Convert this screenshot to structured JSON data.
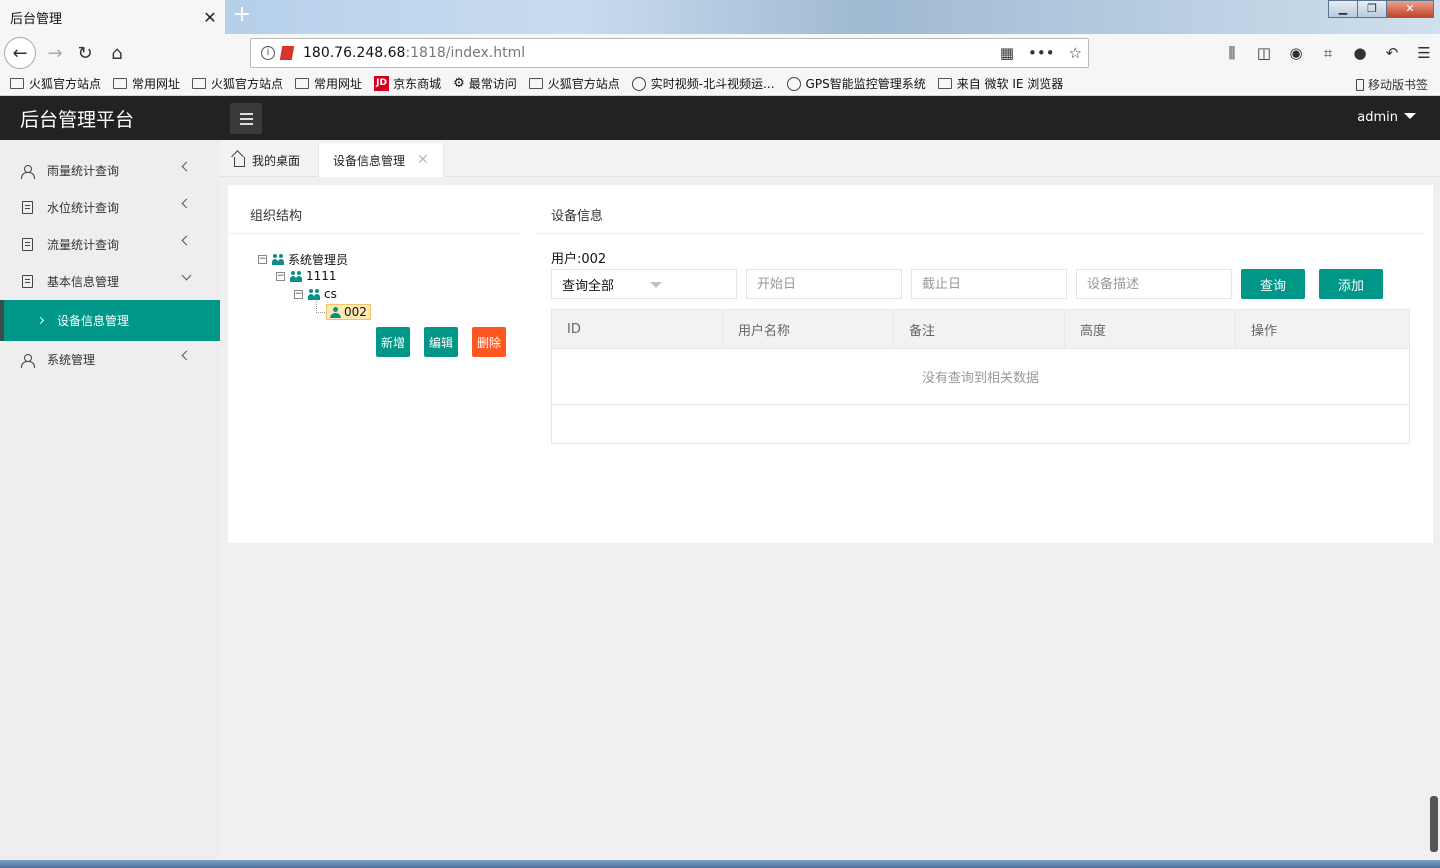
{
  "browser": {
    "tab_title": "后台管理",
    "tab_close": "✕",
    "new_tab": "+",
    "url_host": "180.76.248.68",
    "url_rest": ":1818/index.html",
    "window_buttons": [
      "▁",
      "❐",
      "✕"
    ]
  },
  "bookmarks": [
    {
      "label": "火狐官方站点",
      "icon": "folder-icon"
    },
    {
      "label": "常用网址",
      "icon": "folder-icon"
    },
    {
      "label": "火狐官方站点",
      "icon": "folder-icon"
    },
    {
      "label": "常用网址",
      "icon": "folder-icon"
    },
    {
      "label": "京东商城",
      "icon": "jd-icon",
      "badge": "JD"
    },
    {
      "label": "最常访问",
      "icon": "gear-icon"
    },
    {
      "label": "火狐官方站点",
      "icon": "folder-icon"
    },
    {
      "label": "实时视频-北斗视频运...",
      "icon": "globe-icon"
    },
    {
      "label": "GPS智能监控管理系统",
      "icon": "globe-icon"
    },
    {
      "label": "来自 微软 IE 浏览器",
      "icon": "folder-icon"
    }
  ],
  "mobile_bookmarks": "移动版书签",
  "header": {
    "brand": "后台管理平台",
    "user": "admin"
  },
  "sidebar": {
    "items": [
      {
        "label": "雨量统计查询",
        "icon": "user-icon"
      },
      {
        "label": "水位统计查询",
        "icon": "document-icon"
      },
      {
        "label": "流量统计查询",
        "icon": "document-icon"
      },
      {
        "label": "基本信息管理",
        "icon": "document-icon",
        "expanded": true
      },
      {
        "label": "系统管理",
        "icon": "user-icon"
      }
    ],
    "active_sub": "设备信息管理"
  },
  "page_tabs": {
    "home": "我的桌面",
    "active": "设备信息管理",
    "close": "✕"
  },
  "org_panel": {
    "title": "组织结构",
    "tree": {
      "root": "系统管理员",
      "child": "1111",
      "grandchild": "cs",
      "leaf": "002"
    },
    "buttons": {
      "add": "新增",
      "edit": "编辑",
      "delete": "删除"
    }
  },
  "device_panel": {
    "title": "设备信息",
    "user_label": "用户:002",
    "select_value": "查询全部",
    "start_placeholder": "开始日",
    "end_placeholder": "截止日",
    "desc_placeholder": "设备描述",
    "search_button": "查询",
    "add_button": "添加",
    "columns": [
      "ID",
      "用户名称",
      "备注",
      "高度",
      "操作"
    ],
    "empty_text": "没有查询到相关数据"
  },
  "colors": {
    "primary": "#009688",
    "danger": "#ff5722",
    "header_bg": "#222222"
  }
}
